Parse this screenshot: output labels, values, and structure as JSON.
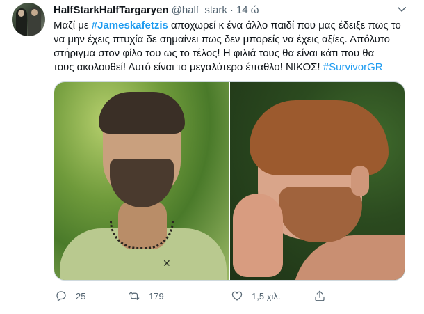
{
  "tweet": {
    "author": {
      "display_name": "HalfStarkHalfTargaryen",
      "handle": "@half_stark",
      "separator": "·",
      "time": "14 ώ"
    },
    "text": {
      "l1_pre": "Μαζί με ",
      "l1_hashtag": "#Jameskafetzis",
      "l1_post": " αποχωρεί κ ένα άλλο παιδί που μας έδειξε πως το",
      "l2": "να μην έχεις πτυχία δε σημαίνει πως δεν μπορείς να έχεις αξίες. Απόλυτο",
      "l3": "στήριγμα στον φίλο του ως το τέλος! Η φιλιά τους θα είναι κάτι που θα",
      "l4_pre": "τους ακολουθεί! Αυτό είναι το μεγαλύτερο έπαθλο! ΝΙΚΟΣ! ",
      "l4_hashtag": "#SurvivorGR"
    },
    "actions": {
      "reply_count": "25",
      "retweet_count": "179",
      "like_count": "1,5 χιλ.",
      "share_count": ""
    },
    "icons": {
      "more": "more-icon",
      "reply": "reply-icon",
      "retweet": "retweet-icon",
      "like": "heart-icon",
      "share": "share-icon"
    },
    "colors": {
      "link": "#1d9bf0",
      "text": "#0f1419",
      "muted": "#536471"
    }
  }
}
